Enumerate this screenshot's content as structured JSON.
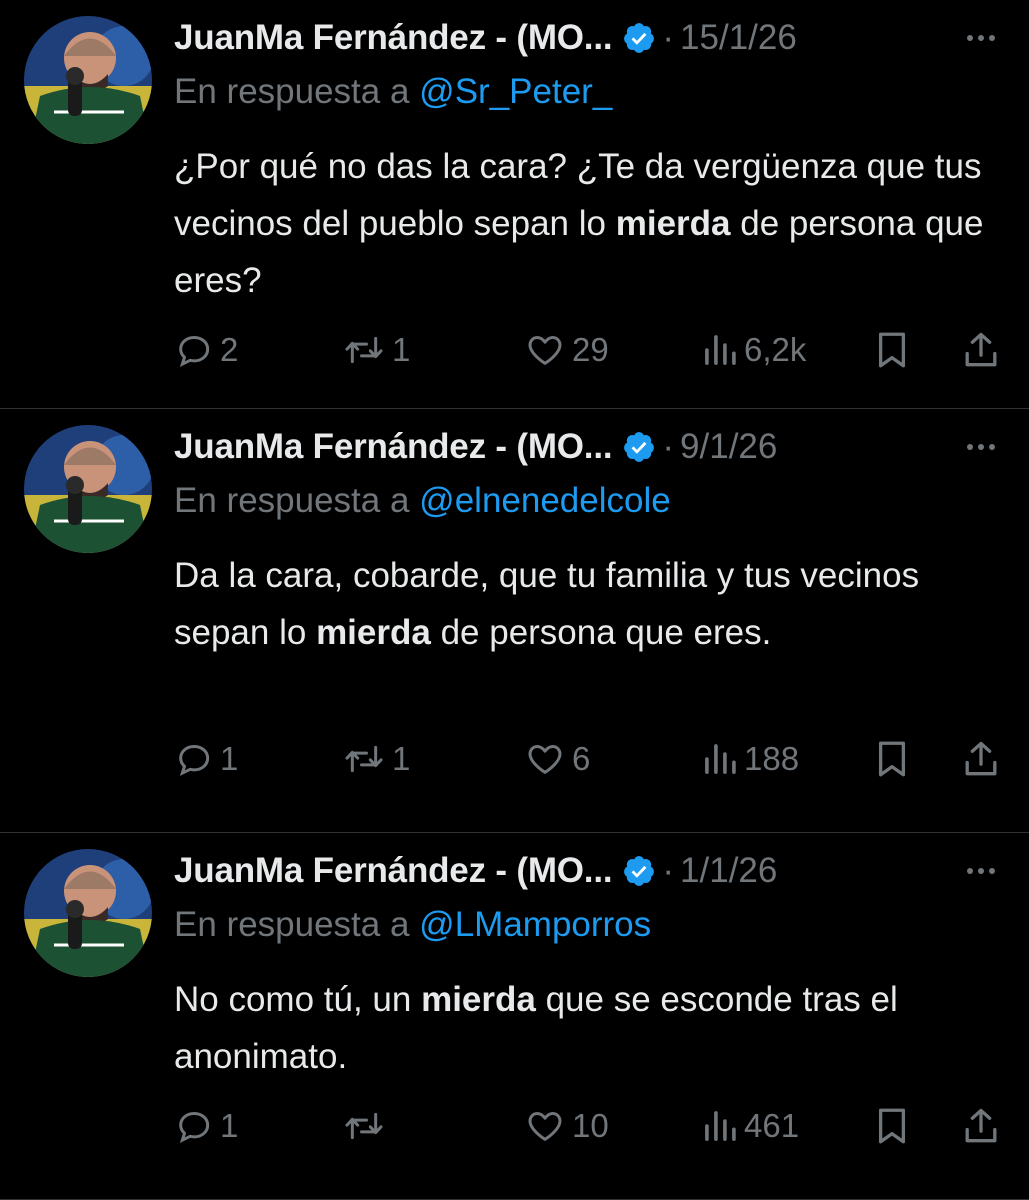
{
  "colors": {
    "background": "#000000",
    "text": "#e7e9ea",
    "muted": "#71767b",
    "link": "#1d9bf0",
    "verified": "#1d9bf0",
    "divider": "#2f3336"
  },
  "tweets": [
    {
      "author": "JuanMa Fernández - (MO...",
      "separator": "·",
      "date": "15/1/26",
      "reply_prefix": "En respuesta a",
      "reply_handle": "@Sr_Peter_",
      "text_parts": [
        "¿Por qué no das la cara? ¿Te da vergüenza que tus vecinos del pueblo sepan lo ",
        "mierda",
        " de persona que eres?"
      ],
      "replies": "2",
      "reposts": "1",
      "likes": "29",
      "views": "6,2k"
    },
    {
      "author": "JuanMa Fernández - (MO...",
      "separator": "·",
      "date": "9/1/26",
      "reply_prefix": "En respuesta a",
      "reply_handle": "@elnenedelcole",
      "text_parts": [
        "Da la cara, cobarde, que tu familia y tus vecinos sepan lo ",
        "mierda",
        " de persona que eres."
      ],
      "replies": "1",
      "reposts": "1",
      "likes": "6",
      "views": "188"
    },
    {
      "author": "JuanMa Fernández - (MO...",
      "separator": "·",
      "date": "1/1/26",
      "reply_prefix": "En respuesta a",
      "reply_handle": "@LMamporros",
      "text_parts": [
        "No como tú, un ",
        "mierda",
        " que se esconde tras el anonimato."
      ],
      "replies": "1",
      "reposts": "",
      "likes": "10",
      "views": "461"
    }
  ],
  "icons": {
    "avatar": "profile-photo",
    "verified": "verified-badge-icon",
    "more": "more-dots-icon",
    "reply": "comment-bubble-icon",
    "repost": "repost-arrows-icon",
    "like": "heart-icon",
    "views": "bar-chart-icon",
    "bookmark": "bookmark-icon",
    "share": "share-upload-icon"
  }
}
